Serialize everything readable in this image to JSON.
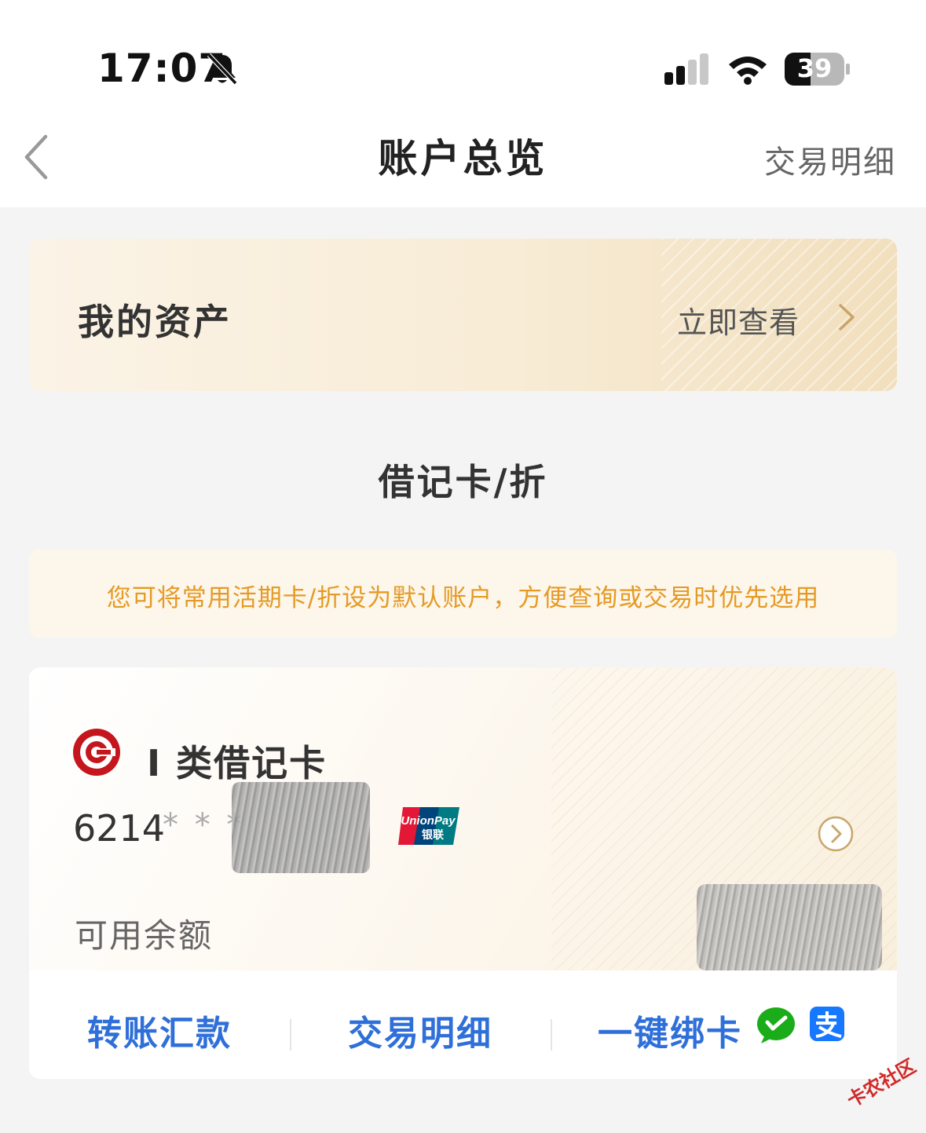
{
  "status_bar": {
    "time": "17:07",
    "battery": "39"
  },
  "nav": {
    "title": "账户总览",
    "right_action": "交易明细"
  },
  "assets": {
    "title": "我的资产",
    "link": "立即查看"
  },
  "section": {
    "title": "借记卡/折"
  },
  "tip": {
    "text": "您可将常用活期卡/折设为默认账户，方便查询或交易时优先选用"
  },
  "card": {
    "type": "I 类借记卡",
    "number_prefix": "6214",
    "number_mask": "* * *",
    "balance_label": "可用余额",
    "unionpay_text": "UnionPay",
    "unionpay_cn": "银联",
    "actions": {
      "transfer": "转账汇款",
      "details": "交易明细",
      "bind": "一键绑卡"
    }
  },
  "icons": {
    "bell": "bell-slash-icon",
    "signal": "cellular-signal-icon",
    "wifi": "wifi-icon",
    "back": "chevron-left-icon",
    "chevron": "chevron-right-icon",
    "wechat": "wechat-pay-icon",
    "alipay": "alipay-icon"
  },
  "colors": {
    "accent_blue": "#2f6fd9",
    "tip_orange": "#e59a25",
    "gold": "#c9a56a",
    "bank_red": "#c4161c"
  },
  "watermark": "卡农社区"
}
